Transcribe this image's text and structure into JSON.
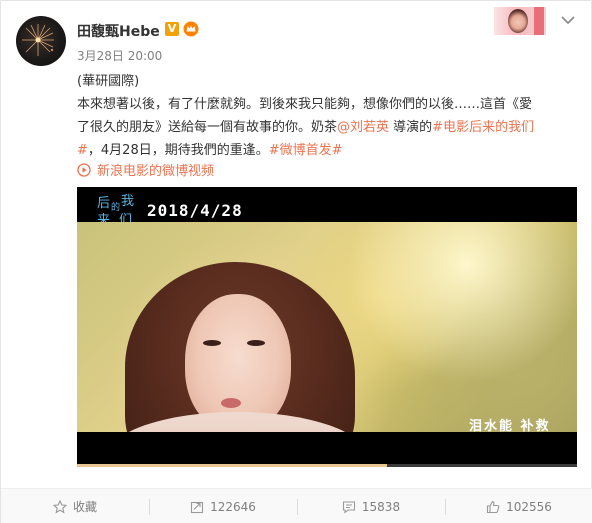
{
  "user": {
    "name": "田馥甄Hebe",
    "verified_badge": "V",
    "post_time": "3月28日 20:00"
  },
  "post": {
    "line1": "(華研國際)",
    "line2": "本來想著以後，有了什麼就夠。到後來我只能夠，想像你們的以後……這首《愛",
    "line3_a": "了很久的朋友》送給每一個有故事的你。奶茶",
    "line3_mention": "@刘若英",
    "line3_b": " 導演的",
    "line3_tag": "#电影后来的我们",
    "line4_tag_end": "#",
    "line4_a": "，4月28日，期待我們的重逢。",
    "line4_tag": "#微博首发#"
  },
  "video": {
    "source_label": "新浪电影的微博视频",
    "date_text": "2018/4/28",
    "logo_text": "后来的我们",
    "subtitle": "泪水能 补救",
    "progress_fraction": 0.62
  },
  "actions": {
    "favorite_label": "收藏",
    "repost_count": "122646",
    "comment_count": "15838",
    "like_count": "102556"
  },
  "colors": {
    "link": "#eb7350",
    "verified": "#f1a208",
    "text": "#333333",
    "muted": "#808080"
  }
}
